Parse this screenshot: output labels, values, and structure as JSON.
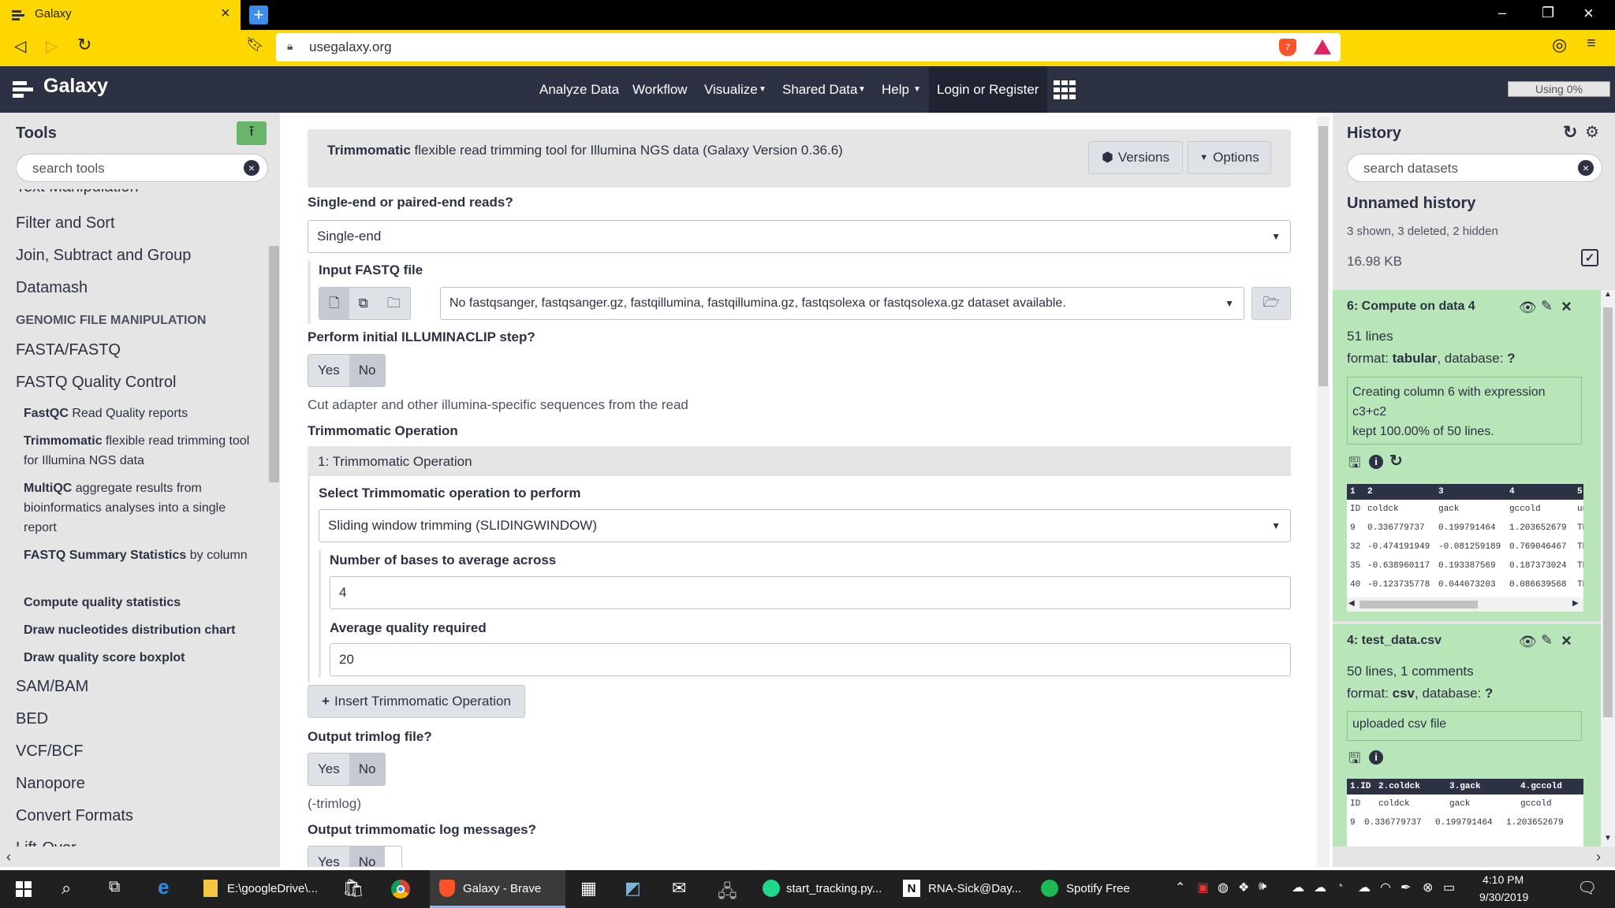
{
  "browser": {
    "tab_title": "Galaxy",
    "url": "usegalaxy.org",
    "shield_count": "7"
  },
  "masthead": {
    "brand": "Galaxy",
    "nav": [
      "Analyze Data",
      "Workflow",
      "Visualize",
      "Shared Data",
      "Help",
      "Login or Register"
    ],
    "quota": "Using 0%"
  },
  "tools": {
    "title": "Tools",
    "search_placeholder": "search tools",
    "partial_top": "Text Manipulation",
    "sections": [
      "Filter and Sort",
      "Join, Subtract and Group",
      "Datamash"
    ],
    "category": "GENOMIC FILE MANIPULATION",
    "sections2": [
      "FASTA/FASTQ",
      "FASTQ Quality Control"
    ],
    "items": [
      {
        "name": "FastQC",
        "desc": " Read Quality reports"
      },
      {
        "name": "Trimmomatic",
        "desc": " flexible read trimming tool for Illumina NGS data"
      },
      {
        "name": "MultiQC",
        "desc": " aggregate results from bioinformatics analyses into a single report"
      },
      {
        "name": "FASTQ Summary Statistics",
        "desc": " by column"
      },
      {
        "name": "Compute quality statistics",
        "desc": ""
      },
      {
        "name": "Draw nucleotides distribution chart",
        "desc": ""
      },
      {
        "name": "Draw quality score boxplot",
        "desc": ""
      }
    ],
    "sections3": [
      "SAM/BAM",
      "BED",
      "VCF/BCF",
      "Nanopore",
      "Convert Formats"
    ],
    "partial_bottom": "Lift-Over"
  },
  "form": {
    "tool_name": "Trimmomatic",
    "tool_desc": " flexible read trimming tool for Illumina NGS data (Galaxy Version 0.36.6)",
    "versions": "Versions",
    "options": "Options",
    "reads_label": "Single-end or paired-end reads?",
    "reads_value": "Single-end",
    "fastq_label": "Input FASTQ file",
    "fastq_value": "No fastqsanger, fastqsanger.gz, fastqillumina, fastqillumina.gz, fastqsolexa or fastqsolexa.gz dataset available.",
    "illumina_label": "Perform initial ILLUMINACLIP step?",
    "yes": "Yes",
    "no": "No",
    "illumina_help": "Cut adapter and other illumina-specific sequences from the read",
    "op_label": "Trimmomatic Operation",
    "op_block_title": "1: Trimmomatic Operation",
    "op_select_label": "Select Trimmomatic operation to perform",
    "op_select_value": "Sliding window trimming (SLIDINGWINDOW)",
    "bases_label": "Number of bases to average across",
    "bases_value": "4",
    "quality_label": "Average quality required",
    "quality_value": "20",
    "insert_label": "Insert Trimmomatic Operation",
    "trimlog_label": "Output trimlog file?",
    "trimlog_help": "(-trimlog)",
    "logmsg_label": "Output trimmomatic log messages?"
  },
  "history": {
    "title": "History",
    "search_placeholder": "search datasets",
    "name": "Unnamed history",
    "counts": "3 shown, 3 deleted, 2 hidden",
    "size": "16.98 KB",
    "item1": {
      "title": "6: Compute on data 4",
      "lines": "51 lines",
      "format_label": "format: ",
      "format": "tabular",
      "db_label": ", database: ",
      "db": "?",
      "info": "Creating column 6 with expression c3+c2\nkept 100.00% of 50 lines.",
      "peek_head": [
        "1",
        "2",
        "3",
        "4",
        "5"
      ],
      "peek_rows": [
        [
          "ID",
          "coldck",
          "gack",
          "gccold",
          "un"
        ],
        [
          "9",
          "0.336779737",
          "0.199791464",
          "1.203652679",
          "TR"
        ],
        [
          "32",
          "-0.474191949",
          "-0.081259189",
          "0.769046467",
          "TR"
        ],
        [
          "35",
          "-0.638960117",
          "0.193387569",
          "0.187373024",
          "TR"
        ],
        [
          "40",
          "-0.123735778",
          "0.044073203",
          "0.086639568",
          "TR"
        ]
      ]
    },
    "item2": {
      "title": "4: test_data.csv",
      "lines": "50 lines, 1 comments",
      "format_label": "format: ",
      "format": "csv",
      "db_label": ", database: ",
      "db": "?",
      "info": "uploaded csv file",
      "peek_head": [
        "1.ID",
        "2.coldck",
        "3.gack",
        "4.gccold"
      ],
      "peek_rows": [
        [
          "ID",
          "coldck",
          "gack",
          "gccold"
        ],
        [
          "9",
          "0.336779737",
          "0.199791464",
          "1.203652679"
        ]
      ]
    }
  },
  "taskbar": {
    "items": [
      "E:\\googleDrive\\...",
      "Galaxy - Brave",
      "start_tracking.py...",
      "RNA-Sick@Day...",
      "Spotify Free"
    ],
    "time": "4:10 PM",
    "date": "9/30/2019"
  },
  "colors": {
    "masthead": "#2c3143",
    "browser_accent": "#ffd700",
    "history_ok": "#b9e6b9"
  }
}
